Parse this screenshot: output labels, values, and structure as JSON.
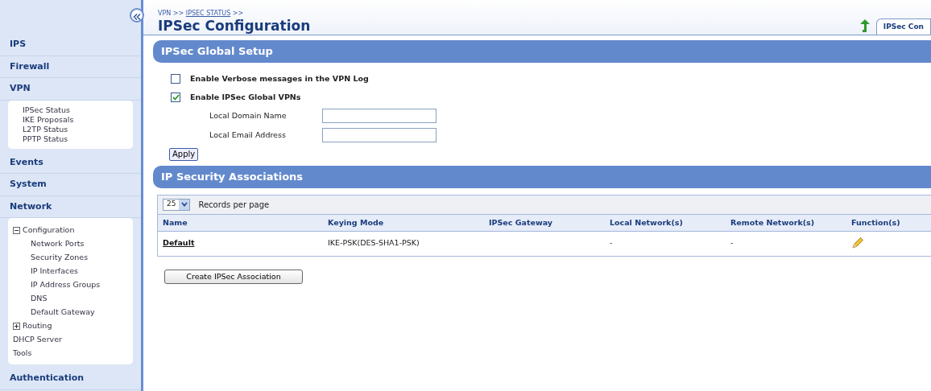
{
  "sidebar": {
    "sections": [
      {
        "label": "IPS"
      },
      {
        "label": "Firewall"
      },
      {
        "label": "VPN",
        "expanded": true,
        "children": [
          {
            "label": "IPSec Status"
          },
          {
            "label": "IKE Proposals"
          },
          {
            "label": "L2TP Status"
          },
          {
            "label": "PPTP Status"
          }
        ]
      },
      {
        "label": "Events"
      },
      {
        "label": "System"
      },
      {
        "label": "Network",
        "expanded": true,
        "children": [
          {
            "label": "Configuration",
            "expanded": true,
            "children": [
              {
                "label": "Network Ports"
              },
              {
                "label": "Security Zones"
              },
              {
                "label": "IP Interfaces"
              },
              {
                "label": "IP Address Groups"
              },
              {
                "label": "DNS"
              },
              {
                "label": "Default Gateway"
              }
            ]
          },
          {
            "label": "Routing",
            "expanded": false
          },
          {
            "label": "DHCP Server"
          },
          {
            "label": "Tools"
          }
        ]
      },
      {
        "label": "Authentication"
      }
    ]
  },
  "breadcrumb": [
    {
      "label": "VPN >>",
      "link": false
    },
    {
      "label": "IPSEC STATUS",
      "link": true
    },
    {
      "label": ">>",
      "link": false
    }
  ],
  "page_title": "IPSec Configuration",
  "tab": {
    "label": "IPSec Con",
    "selected": true
  },
  "global_setup": {
    "title": "IPSec Global Setup",
    "checkboxes": [
      {
        "label": "Enable Verbose messages in the VPN Log",
        "checked": false
      },
      {
        "label": "Enable IPSec Global VPNs",
        "checked": true
      }
    ],
    "fields": [
      {
        "label": "Local Domain Name"
      },
      {
        "label": "Local Email Address"
      }
    ],
    "apply_button": "Apply"
  },
  "associations": {
    "title": "IP Security Associations",
    "records_per_page": {
      "value": "25",
      "label": "Records per page"
    },
    "table": {
      "columns": [
        "Name",
        "Keying Mode",
        "IPSec Gateway",
        "Local Network(s)",
        "Remote Network(s)",
        "Function(s)"
      ],
      "rows": [
        [
          "Default",
          "IKE-PSK(DES-SHA1-PSK)",
          "",
          "-",
          "-"
        ]
      ]
    },
    "create_button": "Create IPSec Association"
  }
}
